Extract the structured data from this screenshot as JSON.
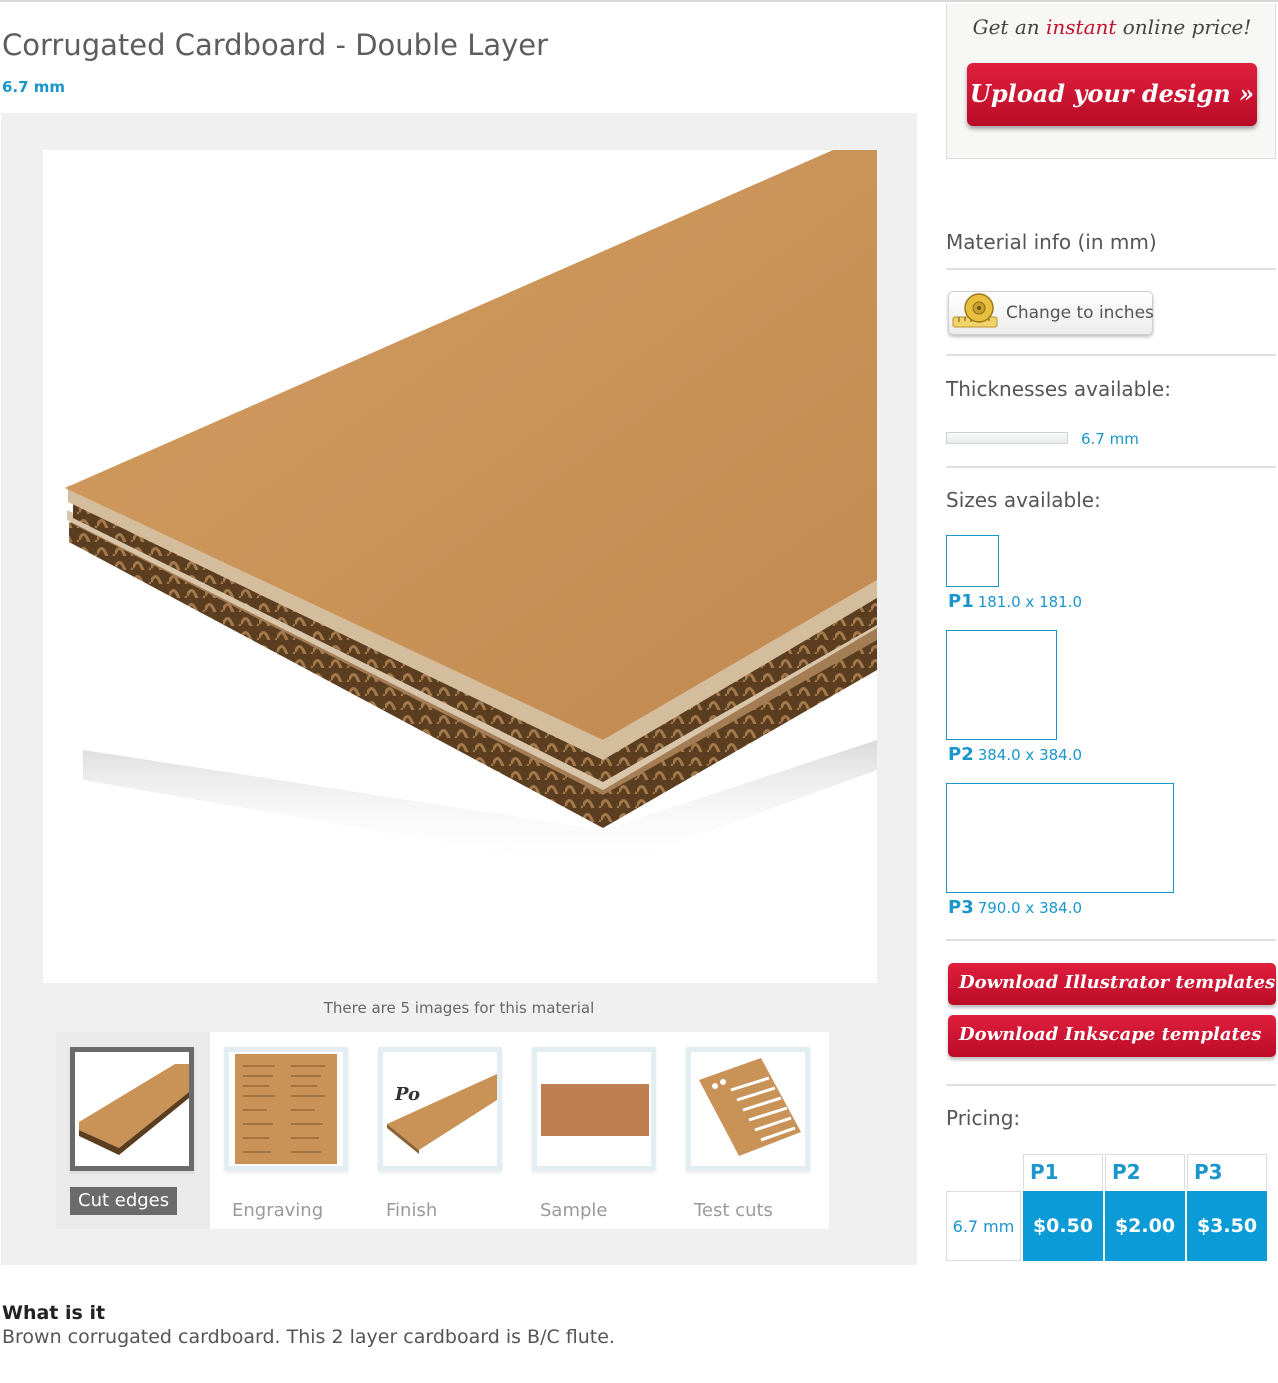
{
  "material": {
    "title": "Corrugated Cardboard - Double Layer",
    "thickness": "6.7 mm"
  },
  "gallery": {
    "image_count_text": "There are 5 images for this material",
    "thumbnails": [
      {
        "label": "Cut edges",
        "active": true
      },
      {
        "label": "Engraving",
        "active": false
      },
      {
        "label": "Finish",
        "active": false
      },
      {
        "label": "Sample",
        "active": false
      },
      {
        "label": "Test cuts",
        "active": false
      }
    ]
  },
  "description": {
    "heading": "What is it",
    "text": "Brown corrugated cardboard. This 2 layer cardboard is B/C flute."
  },
  "sidebar": {
    "cta": {
      "line_before": "Get an ",
      "line_accent": "instant",
      "line_after": " online price!",
      "upload_label": "Upload your design »"
    },
    "material_info_title": "Material info (in mm)",
    "change_units_label": "Change to inches",
    "thicknesses_title": "Thicknesses available:",
    "thicknesses": [
      "6.7 mm"
    ],
    "sizes_title": "Sizes available:",
    "sizes": [
      {
        "code": "P1",
        "dims": "181.0 x 181.0"
      },
      {
        "code": "P2",
        "dims": "384.0 x 384.0"
      },
      {
        "code": "P3",
        "dims": "790.0 x 384.0"
      }
    ],
    "templates": {
      "illustrator_label": "Download Illustrator templates",
      "inkscape_label": "Download Inkscape templates"
    },
    "pricing": {
      "title": "Pricing:",
      "columns": [
        "P1",
        "P2",
        "P3"
      ],
      "rows": [
        {
          "thickness": "6.7 mm",
          "prices": [
            "$0.50",
            "$2.00",
            "$3.50"
          ]
        }
      ]
    }
  },
  "colors": {
    "accent_blue": "#1a96cc",
    "price_blue": "#0b9bd6",
    "button_red": "#c8102e",
    "cardboard": "#c79258",
    "gallery_bg": "#eff0ef"
  }
}
